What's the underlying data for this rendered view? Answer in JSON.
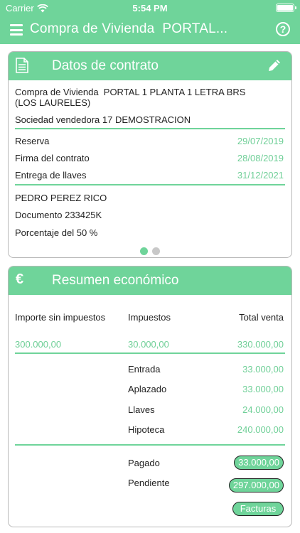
{
  "status": {
    "carrier": "Carrier",
    "time": "5:54 PM"
  },
  "nav": {
    "title": "Compra de Vivienda  PORTAL..."
  },
  "contract": {
    "title": "Datos de contrato",
    "description_line1": "Compra de Vivienda  PORTAL 1 PLANTA 1 LETRA BRS",
    "description_line2": "(LOS LAURELES)",
    "seller": "Sociedad vendedora 17 DEMOSTRACION",
    "dates": [
      {
        "label": "Reserva",
        "value": "29/07/2019"
      },
      {
        "label": "Firma del contrato",
        "value": "28/08/2019"
      },
      {
        "label": "Entrega de llaves",
        "value": "31/12/2021"
      }
    ],
    "buyer_name": "PEDRO PEREZ RICO",
    "document": "Documento 233425K",
    "percentage": "Porcentaje del 50 %"
  },
  "summary": {
    "title": "Resumen económico",
    "headers": {
      "base": "Importe sin impuestos",
      "taxes": "Impuestos",
      "total": "Total venta"
    },
    "values": {
      "base": "300.000,00",
      "taxes": "30.000,00",
      "total": "330.000,00"
    },
    "breakdown": [
      {
        "label": "Entrada",
        "value": "33.000,00"
      },
      {
        "label": "Aplazado",
        "value": "33.000,00"
      },
      {
        "label": "Llaves",
        "value": "24.000,00"
      },
      {
        "label": "Hipoteca",
        "value": "240.000,00"
      }
    ],
    "paid_label": "Pagado",
    "paid_value": "33.000,00",
    "pending_label": "Pendiente",
    "pending_value": "297.000,00",
    "invoices_button": "Facturas"
  }
}
